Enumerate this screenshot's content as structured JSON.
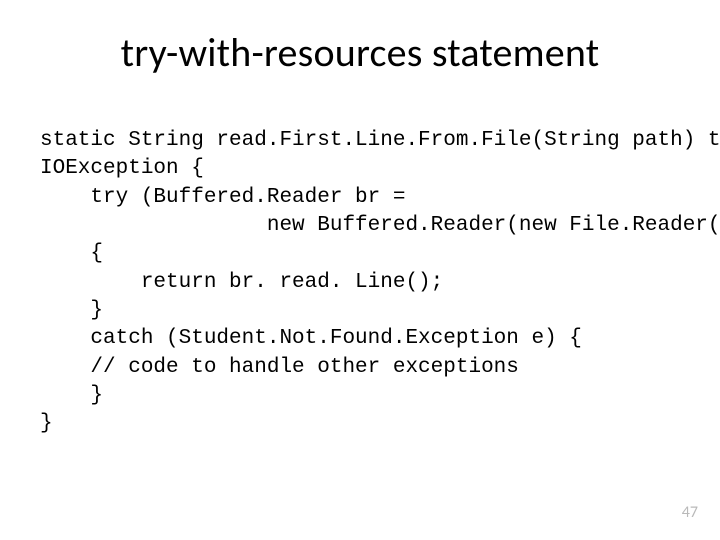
{
  "slide": {
    "title": "try-with-resources statement",
    "code": "static String read.First.Line.From.File(String path) throws\nIOException {\n    try (Buffered.Reader br =\n                  new Buffered.Reader(new File.Reader(path)))\n    {\n        return br. read. Line();\n    }\n    catch (Student.Not.Found.Exception e) {\n    // code to handle other exceptions\n    }\n}",
    "page_number": "47"
  }
}
